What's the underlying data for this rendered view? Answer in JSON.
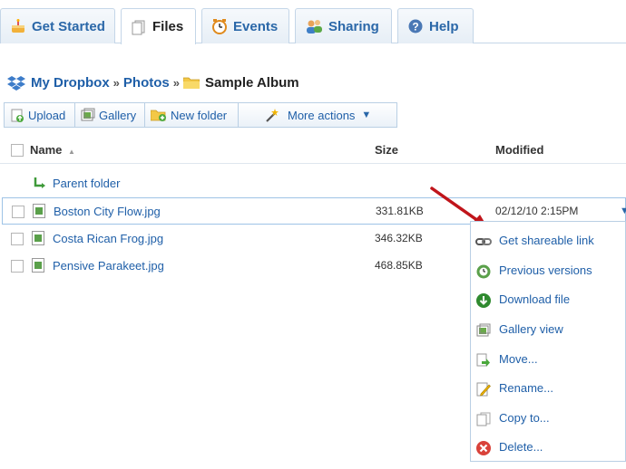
{
  "tabs": [
    {
      "label": "Get Started"
    },
    {
      "label": "Files"
    },
    {
      "label": "Events"
    },
    {
      "label": "Sharing"
    },
    {
      "label": "Help"
    }
  ],
  "breadcrumb": {
    "root": "My Dropbox",
    "separator": "»",
    "folder": "Photos",
    "current": "Sample Album"
  },
  "toolbar": {
    "upload": "Upload",
    "gallery": "Gallery",
    "new_folder": "New folder",
    "more_actions": "More actions"
  },
  "table": {
    "headers": {
      "name": "Name",
      "size": "Size",
      "modified": "Modified"
    },
    "parent_folder": "Parent folder",
    "rows": [
      {
        "name": "Boston City Flow.jpg",
        "size": "331.81KB",
        "modified": "02/12/10  2:15PM"
      },
      {
        "name": "Costa Rican Frog.jpg",
        "size": "346.32KB",
        "modified": ""
      },
      {
        "name": "Pensive Parakeet.jpg",
        "size": "468.85KB",
        "modified": ""
      }
    ]
  },
  "context_menu": [
    {
      "label": "Get shareable link",
      "icon": "link-icon"
    },
    {
      "label": "Previous versions",
      "icon": "versions-icon"
    },
    {
      "label": "Download file",
      "icon": "download-icon"
    },
    {
      "label": "Gallery view",
      "icon": "gallery-icon"
    },
    {
      "label": "Move...",
      "icon": "move-icon"
    },
    {
      "label": "Rename...",
      "icon": "rename-icon"
    },
    {
      "label": "Copy to...",
      "icon": "copy-icon"
    },
    {
      "label": "Delete...",
      "icon": "delete-icon"
    }
  ],
  "colors": {
    "link": "#1f5fa8",
    "border": "#c4d6e8",
    "annotation_arrow": "#c0151b"
  }
}
